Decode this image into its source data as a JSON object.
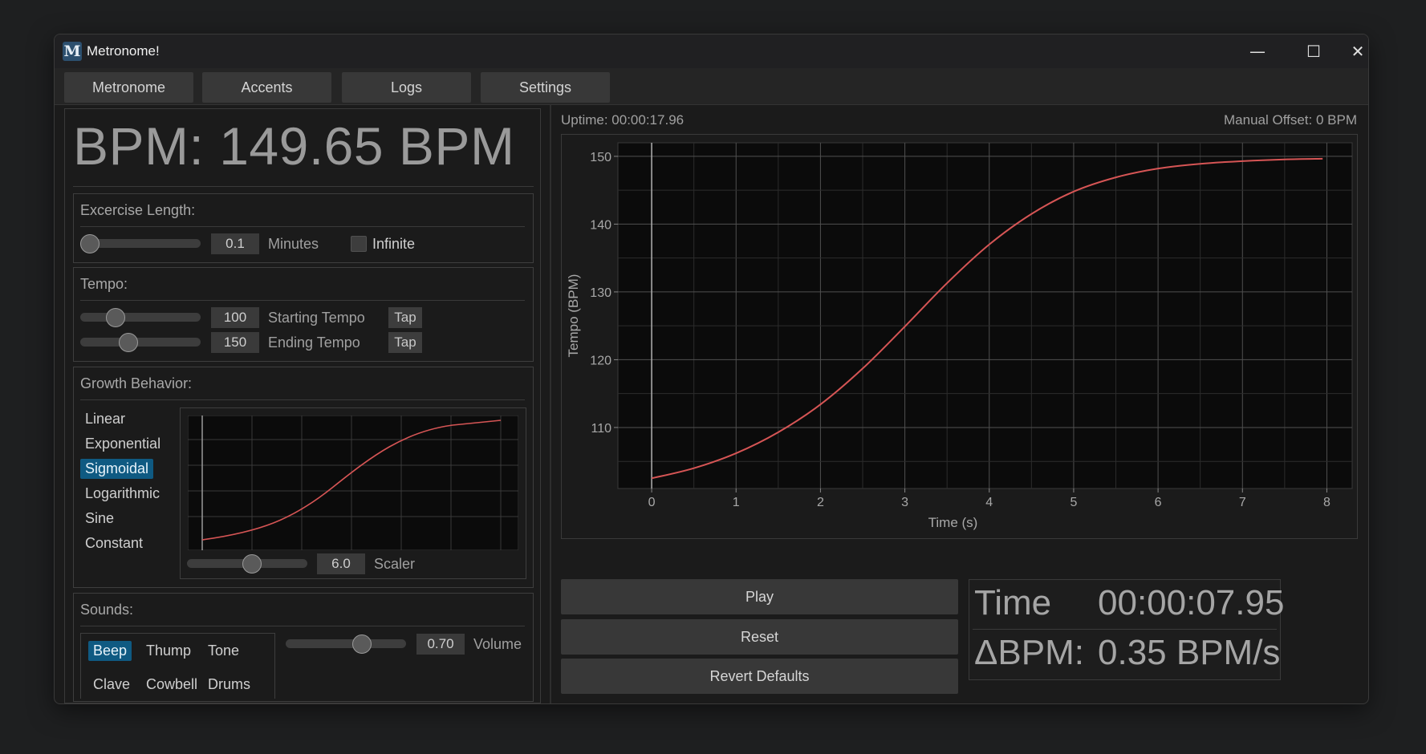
{
  "window": {
    "title": "Metronome!",
    "controls": {
      "minimize": "—",
      "maximize": "☐",
      "close": "✕"
    }
  },
  "menu": {
    "tabs": [
      "Metronome",
      "Accents",
      "Logs",
      "Settings"
    ]
  },
  "left": {
    "bpm_display": "BPM: 149.65 BPM",
    "exercise": {
      "title": "Excercise Length:",
      "minutes_value": "0.1",
      "minutes_slider_fraction": 0.0,
      "minutes_label": "Minutes",
      "infinite_label": "Infinite",
      "infinite_checked": false
    },
    "tempo": {
      "title": "Tempo:",
      "starting_value": "100",
      "starting_fraction": 0.25,
      "starting_label": "Starting Tempo",
      "ending_value": "150",
      "ending_fraction": 0.38,
      "ending_label": "Ending Tempo",
      "tap_label": "Tap"
    },
    "growth": {
      "title": "Growth Behavior:",
      "options": [
        "Linear",
        "Exponential",
        "Sigmoidal",
        "Logarithmic",
        "Sine",
        "Constant"
      ],
      "selected": "Sigmoidal",
      "scaler_value": "6.0",
      "scaler_fraction": 0.55,
      "scaler_label": "Scaler"
    },
    "sounds": {
      "title": "Sounds:",
      "options": [
        "Beep",
        "Thump",
        "Tone",
        "Clave",
        "Cowbell",
        "Drums"
      ],
      "selected": "Beep",
      "volume_value": "0.70",
      "volume_fraction": 0.66,
      "volume_label": "Volume"
    }
  },
  "right": {
    "uptime": "Uptime: 00:00:17.96",
    "manual_offset": "Manual Offset: 0 BPM",
    "buttons": {
      "play": "Play",
      "reset": "Reset",
      "revert": "Revert Defaults"
    },
    "stats": {
      "time_label": "Time",
      "time_value": "00:00:07.95",
      "dbpm_label": "ΔBPM:",
      "dbpm_value": "0.35 BPM/s"
    }
  },
  "colors": {
    "curve": "#d65555",
    "selected": "#0f5a82",
    "grid": "#4a4a4a",
    "plot_bg": "#0b0b0b"
  },
  "chart_data": {
    "type": "line",
    "title": "",
    "xlabel": "Time (s)",
    "ylabel": "Tempo (BPM)",
    "xlim": [
      -0.4,
      8.3
    ],
    "ylim": [
      101,
      152
    ],
    "xticks": [
      0,
      1,
      2,
      3,
      4,
      5,
      6,
      7,
      8
    ],
    "yticks": [
      110,
      120,
      130,
      140,
      150
    ],
    "grid": true,
    "series": [
      {
        "x": [
          0,
          0.5,
          1,
          1.5,
          2,
          2.5,
          3,
          3.5,
          4,
          4.5,
          5,
          5.5,
          6,
          6.5,
          7,
          7.5,
          7.95
        ],
        "y": [
          102.5,
          104.0,
          106.2,
          109.3,
          113.4,
          118.7,
          124.9,
          131.3,
          137.0,
          141.5,
          144.8,
          146.9,
          148.2,
          148.9,
          149.3,
          149.55,
          149.65
        ]
      }
    ]
  }
}
